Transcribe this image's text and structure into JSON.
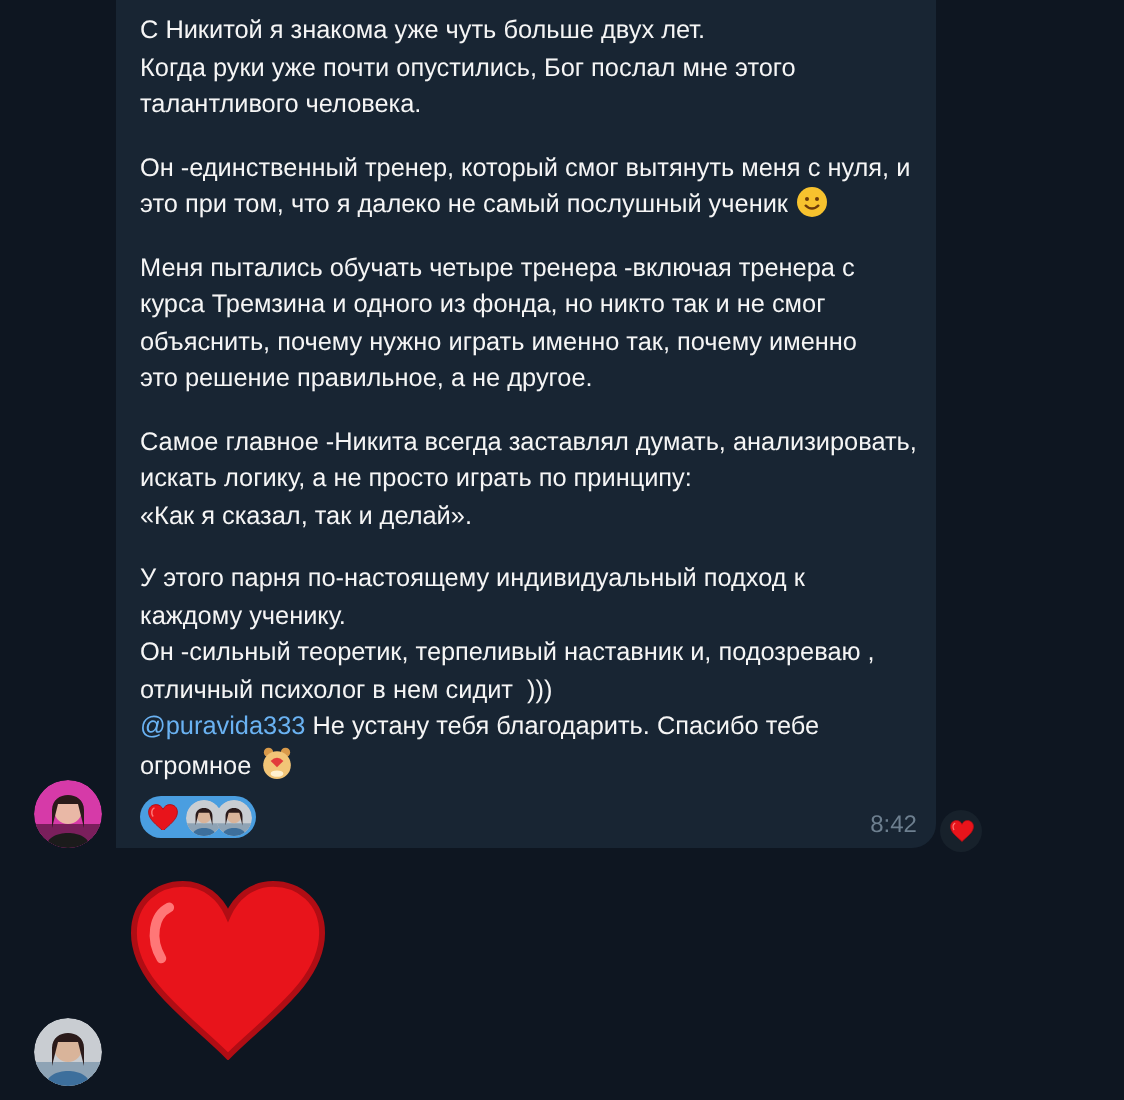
{
  "message": {
    "paragraphs": [
      {
        "text": "С Никитой я знакома уже чуть больше двух лет.\nКогда руки уже почти опустились, Бог послал мне этого\nталантливого человека."
      },
      {
        "text": "Он -единственный тренер, который смог вытянуть меня с нуля, и\nэто при том, что я далеко не самый послушный ученик",
        "emoji": {
          "kind": "smile"
        }
      },
      {
        "text": "Меня пытались обучать четыре тренера -включая тренера с\nкурса Тремзина и одного из фонда, но никто так и не смог\nобъяснить, почему нужно играть именно так, почему именно\nэто решение правильное, а не другое."
      },
      {
        "text": "Самое главное -Никита всегда заставлял думать, анализировать,\nискать логику, а не просто играть по принципу:\n«Как я сказал, так и делай»."
      },
      {
        "text": "У этого парня по-настоящему индивидуальный подход к\nкаждому ученику.\nОн -сильный теоретик, терпеливый наставник и, подозреваю ,\nотличный психолог в нем сидит  )))"
      }
    ],
    "mention": "@puravida333",
    "closing": " Не устану тебя благодарить. Спасибо тебе\nогромное",
    "closing_emoji": {
      "kind": "bear"
    },
    "reaction": {
      "selected": true,
      "items": [
        {
          "kind": "heart"
        },
        {
          "kind": "picture"
        },
        {
          "kind": "picture"
        }
      ]
    },
    "time": "8:42"
  },
  "quick_reaction": {
    "kind": "heart"
  },
  "sticker": {
    "kind": "heart"
  }
}
